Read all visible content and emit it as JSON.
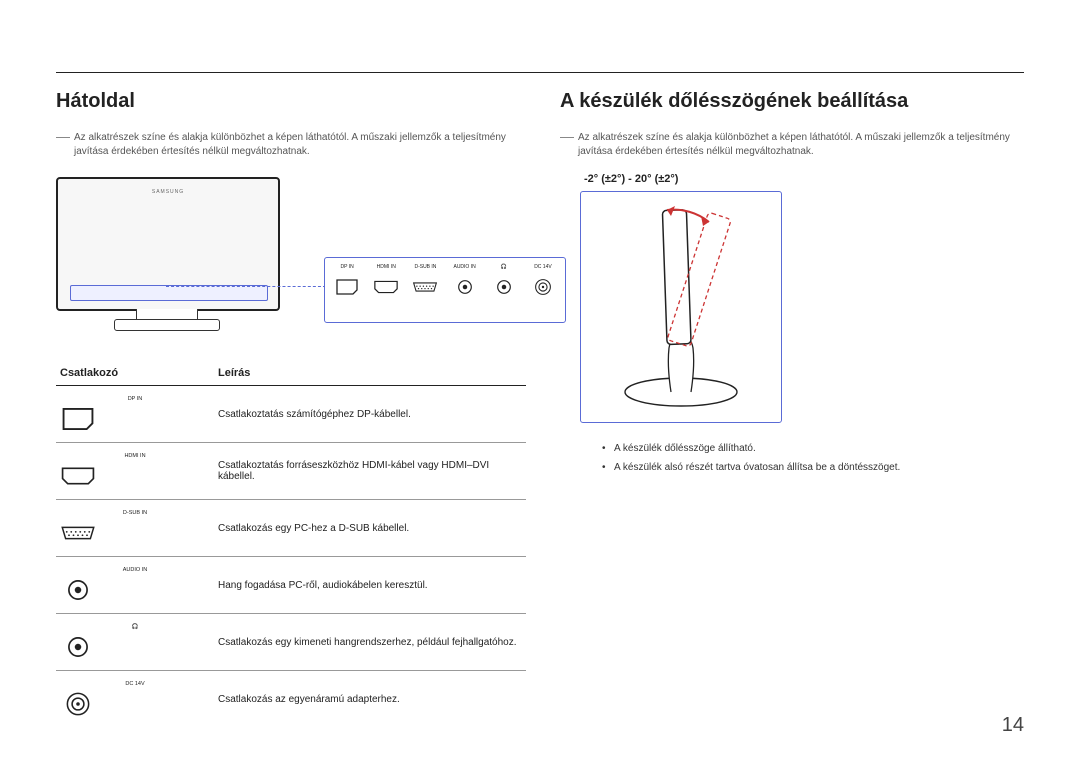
{
  "page_number": "14",
  "left": {
    "heading": "Hátoldal",
    "note": "Az alkatrészek színe és alakja különbözhet a képen láthatótól. A műszaki jellemzők a teljesítmény javítása érdekében értesítés nélkül megváltozhatnak.",
    "brand": "SAMSUNG",
    "panel_ports": [
      {
        "label": "DP IN",
        "shape": "dp"
      },
      {
        "label": "HDMI IN",
        "shape": "hdmi"
      },
      {
        "label": "D-SUB IN",
        "shape": "dsub"
      },
      {
        "label": "AUDIO IN",
        "shape": "jack"
      },
      {
        "label": "🎧",
        "shape": "jack"
      },
      {
        "label": "DC 14V",
        "shape": "dc"
      }
    ],
    "table": {
      "headers": {
        "c1": "Csatlakozó",
        "c2": "Leírás"
      },
      "rows": [
        {
          "label": "DP IN",
          "shape": "dp",
          "desc": "Csatlakoztatás számítógéphez DP-kábellel."
        },
        {
          "label": "HDMI IN",
          "shape": "hdmi",
          "desc": "Csatlakoztatás forráseszközhöz HDMI-kábel vagy HDMI–DVI kábellel."
        },
        {
          "label": "D-SUB IN",
          "shape": "dsub",
          "desc": "Csatlakozás egy PC-hez a D-SUB kábellel."
        },
        {
          "label": "AUDIO IN",
          "shape": "jack",
          "desc": "Hang fogadása PC-ről, audiokábelen keresztül."
        },
        {
          "label": "🎧",
          "shape": "jack",
          "desc": "Csatlakozás egy kimeneti hangrendszerhez, például fejhallgatóhoz."
        },
        {
          "label": "DC 14V",
          "shape": "dc",
          "desc": "Csatlakozás az egyenáramú adapterhez."
        }
      ]
    }
  },
  "right": {
    "heading": "A készülék dőlésszögének beállítása",
    "note": "Az alkatrészek színe és alakja különbözhet a képen láthatótól. A műszaki jellemzők a teljesítmény javítása érdekében értesítés nélkül megváltozhatnak.",
    "tilt_caption": "-2° (±2°) - 20° (±2°)",
    "bullets": [
      "A készülék dőlésszöge állítható.",
      "A készülék alsó részét tartva óvatosan állítsa be a döntésszöget."
    ]
  }
}
